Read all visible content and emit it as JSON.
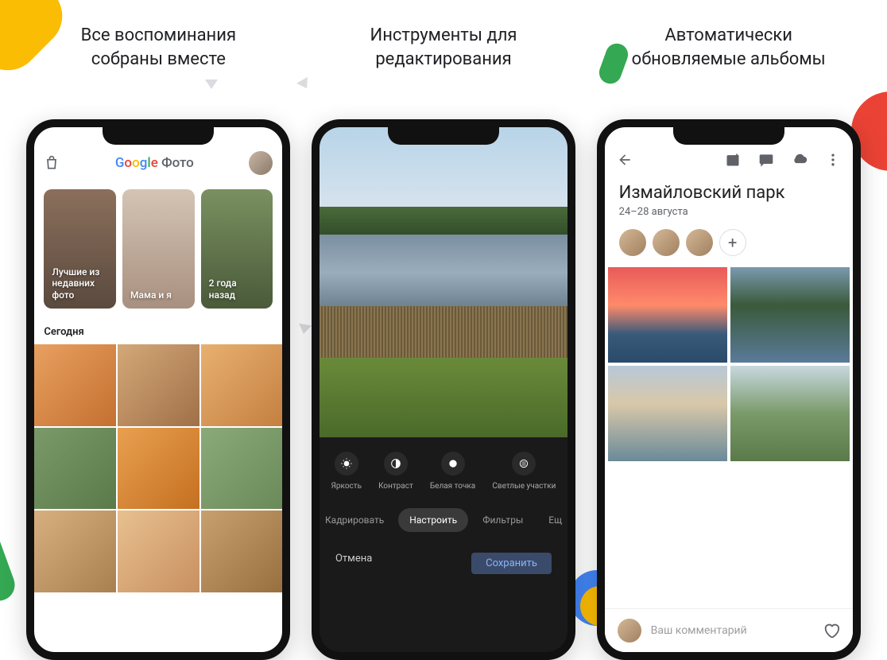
{
  "headings": {
    "h1": "Все воспоминания\nсобраны вместе",
    "h2": "Инструменты для\nредактирования",
    "h3": "Автоматически\nобновляемые альбомы"
  },
  "phone1": {
    "app_name_suffix": "Фото",
    "stories": [
      {
        "label": "Лучшие из недавних фото"
      },
      {
        "label": "Мама и я"
      },
      {
        "label": "2 года назад"
      }
    ],
    "section": "Сегодня"
  },
  "phone2": {
    "adjustments": [
      {
        "label": "Яркость",
        "icon": "brightness"
      },
      {
        "label": "Контраст",
        "icon": "contrast"
      },
      {
        "label": "Белая точка",
        "icon": "whitepoint"
      },
      {
        "label": "Светлые участки",
        "icon": "highlights"
      }
    ],
    "tabs": {
      "crop": "Кадрировать",
      "adjust": "Настроить",
      "filters": "Фильтры",
      "more": "Ещ"
    },
    "cancel": "Отмена",
    "save": "Сохранить"
  },
  "phone3": {
    "title": "Измайловский парк",
    "date": "24–28 августа",
    "comment_placeholder": "Ваш комментарий",
    "add": "+"
  }
}
